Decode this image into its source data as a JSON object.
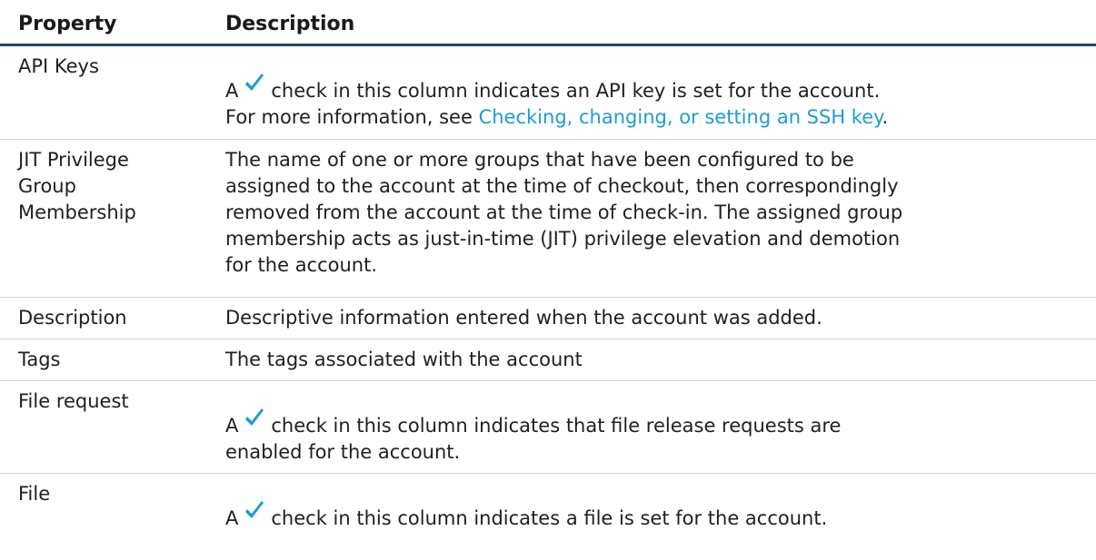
{
  "table": {
    "headers": {
      "property": "Property",
      "description": "Description"
    },
    "rows": [
      {
        "property": "API Keys",
        "desc_prefix": "A",
        "check_icon": "checkmark-icon",
        "desc_line1": "check in this column indicates an API key is set for the account.",
        "desc_line2_prefix": "For more information, see ",
        "link_text": "Checking, changing, or setting an SSH key",
        "desc_line2_suffix": "."
      },
      {
        "property_line1": "JIT Privilege",
        "property_line2": "Group",
        "property_line3": "Membership",
        "description_lines": [
          "The name of one or more groups that have been configured to be",
          "assigned to the account at the time of checkout, then correspondingly",
          "removed from the account at the time of check-in. The assigned group",
          "membership acts as just-in-time (JIT) privilege elevation and demotion",
          "for the account."
        ]
      },
      {
        "property": "Description",
        "description": "Descriptive information entered when the account was added."
      },
      {
        "property": "Tags",
        "description": "The tags associated with the account"
      },
      {
        "property": "File request",
        "desc_prefix": "A",
        "check_icon": "checkmark-icon",
        "desc_line1": "check in this column indicates that file release requests are",
        "desc_line2": "enabled for the account."
      },
      {
        "property": "File",
        "desc_prefix": "A",
        "check_icon": "checkmark-icon",
        "desc_line1": "check in this column indicates a file is set for the account."
      }
    ]
  },
  "colors": {
    "header_rule": "#1f4e63",
    "link": "#1e9bd7",
    "check": "#1e9bd7"
  }
}
